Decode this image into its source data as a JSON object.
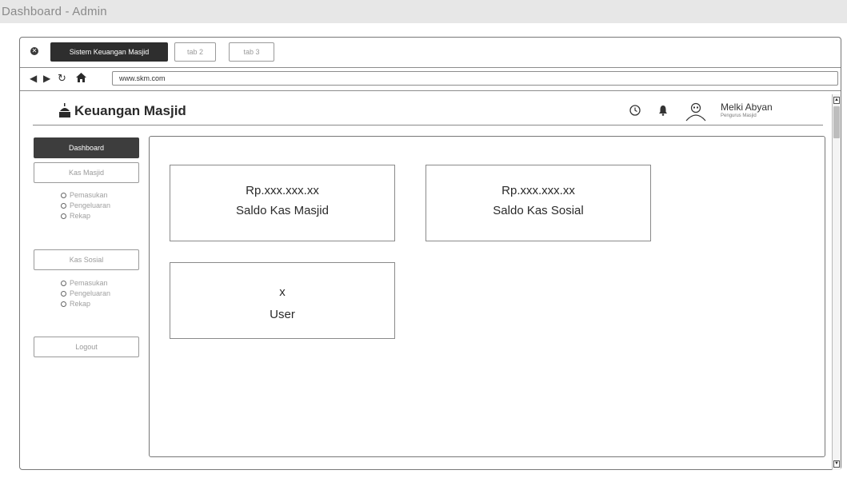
{
  "page": {
    "title": "Dashboard - Admin"
  },
  "browser": {
    "tabs": [
      {
        "label": "Sistem Keuangan Masjid",
        "active": true
      },
      {
        "label": "tab 2",
        "active": false
      },
      {
        "label": "tab 3",
        "active": false
      }
    ],
    "url": "www.skm.com",
    "nav_icons": [
      "back-icon",
      "forward-icon",
      "reload-icon",
      "home-icon"
    ]
  },
  "app": {
    "title": "Keuangan Masjid",
    "logo_icon": "mosque-icon",
    "header_icons": [
      "clock-icon",
      "bell-icon"
    ],
    "user": {
      "name": "Melki Abyan",
      "role": "Pengurus Masjid"
    }
  },
  "sidebar": {
    "dashboard": "Dashboard",
    "kas_masjid": {
      "label": "Kas Masjid",
      "items": [
        "Pemasukan",
        "Pengeluaran",
        "Rekap"
      ]
    },
    "kas_sosial": {
      "label": "Kas Sosial",
      "items": [
        "Pemasukan",
        "Pengeluaran",
        "Rekap"
      ]
    },
    "logout": "Logout"
  },
  "cards": [
    {
      "value": "Rp.xxx.xxx.xx",
      "label": "Saldo Kas Masjid"
    },
    {
      "value": "Rp.xxx.xxx.xx",
      "label": "Saldo Kas Sosial"
    },
    {
      "value": "x",
      "label": "User"
    }
  ],
  "colors": {
    "header_bg": "#e7e7e7",
    "active_bg": "#3d3d3d",
    "border": "#8a8a8a",
    "muted_text": "#9a9a9a"
  }
}
